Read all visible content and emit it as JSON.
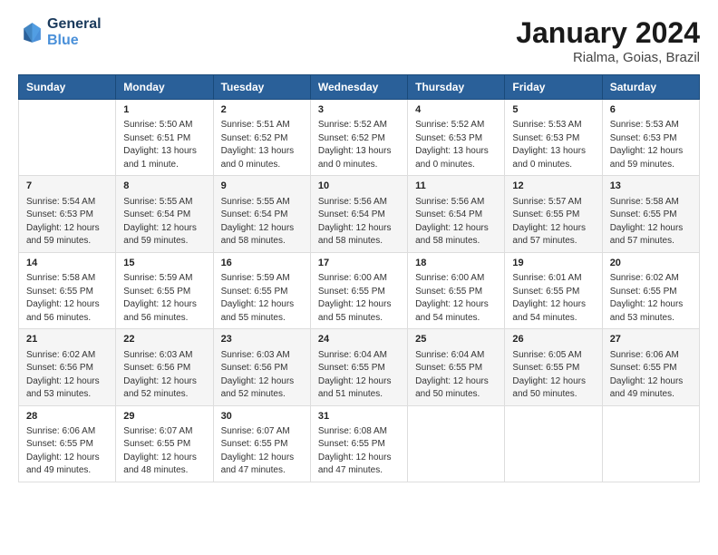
{
  "logo": {
    "line1": "General",
    "line2": "Blue"
  },
  "title": "January 2024",
  "subtitle": "Rialma, Goias, Brazil",
  "days_header": [
    "Sunday",
    "Monday",
    "Tuesday",
    "Wednesday",
    "Thursday",
    "Friday",
    "Saturday"
  ],
  "weeks": [
    [
      {
        "day": "",
        "content": ""
      },
      {
        "day": "1",
        "content": "Sunrise: 5:50 AM\nSunset: 6:51 PM\nDaylight: 13 hours\nand 1 minute."
      },
      {
        "day": "2",
        "content": "Sunrise: 5:51 AM\nSunset: 6:52 PM\nDaylight: 13 hours\nand 0 minutes."
      },
      {
        "day": "3",
        "content": "Sunrise: 5:52 AM\nSunset: 6:52 PM\nDaylight: 13 hours\nand 0 minutes."
      },
      {
        "day": "4",
        "content": "Sunrise: 5:52 AM\nSunset: 6:53 PM\nDaylight: 13 hours\nand 0 minutes."
      },
      {
        "day": "5",
        "content": "Sunrise: 5:53 AM\nSunset: 6:53 PM\nDaylight: 13 hours\nand 0 minutes."
      },
      {
        "day": "6",
        "content": "Sunrise: 5:53 AM\nSunset: 6:53 PM\nDaylight: 12 hours\nand 59 minutes."
      }
    ],
    [
      {
        "day": "7",
        "content": "Sunrise: 5:54 AM\nSunset: 6:53 PM\nDaylight: 12 hours\nand 59 minutes."
      },
      {
        "day": "8",
        "content": "Sunrise: 5:55 AM\nSunset: 6:54 PM\nDaylight: 12 hours\nand 59 minutes."
      },
      {
        "day": "9",
        "content": "Sunrise: 5:55 AM\nSunset: 6:54 PM\nDaylight: 12 hours\nand 58 minutes."
      },
      {
        "day": "10",
        "content": "Sunrise: 5:56 AM\nSunset: 6:54 PM\nDaylight: 12 hours\nand 58 minutes."
      },
      {
        "day": "11",
        "content": "Sunrise: 5:56 AM\nSunset: 6:54 PM\nDaylight: 12 hours\nand 58 minutes."
      },
      {
        "day": "12",
        "content": "Sunrise: 5:57 AM\nSunset: 6:55 PM\nDaylight: 12 hours\nand 57 minutes."
      },
      {
        "day": "13",
        "content": "Sunrise: 5:58 AM\nSunset: 6:55 PM\nDaylight: 12 hours\nand 57 minutes."
      }
    ],
    [
      {
        "day": "14",
        "content": "Sunrise: 5:58 AM\nSunset: 6:55 PM\nDaylight: 12 hours\nand 56 minutes."
      },
      {
        "day": "15",
        "content": "Sunrise: 5:59 AM\nSunset: 6:55 PM\nDaylight: 12 hours\nand 56 minutes."
      },
      {
        "day": "16",
        "content": "Sunrise: 5:59 AM\nSunset: 6:55 PM\nDaylight: 12 hours\nand 55 minutes."
      },
      {
        "day": "17",
        "content": "Sunrise: 6:00 AM\nSunset: 6:55 PM\nDaylight: 12 hours\nand 55 minutes."
      },
      {
        "day": "18",
        "content": "Sunrise: 6:00 AM\nSunset: 6:55 PM\nDaylight: 12 hours\nand 54 minutes."
      },
      {
        "day": "19",
        "content": "Sunrise: 6:01 AM\nSunset: 6:55 PM\nDaylight: 12 hours\nand 54 minutes."
      },
      {
        "day": "20",
        "content": "Sunrise: 6:02 AM\nSunset: 6:55 PM\nDaylight: 12 hours\nand 53 minutes."
      }
    ],
    [
      {
        "day": "21",
        "content": "Sunrise: 6:02 AM\nSunset: 6:56 PM\nDaylight: 12 hours\nand 53 minutes."
      },
      {
        "day": "22",
        "content": "Sunrise: 6:03 AM\nSunset: 6:56 PM\nDaylight: 12 hours\nand 52 minutes."
      },
      {
        "day": "23",
        "content": "Sunrise: 6:03 AM\nSunset: 6:56 PM\nDaylight: 12 hours\nand 52 minutes."
      },
      {
        "day": "24",
        "content": "Sunrise: 6:04 AM\nSunset: 6:55 PM\nDaylight: 12 hours\nand 51 minutes."
      },
      {
        "day": "25",
        "content": "Sunrise: 6:04 AM\nSunset: 6:55 PM\nDaylight: 12 hours\nand 50 minutes."
      },
      {
        "day": "26",
        "content": "Sunrise: 6:05 AM\nSunset: 6:55 PM\nDaylight: 12 hours\nand 50 minutes."
      },
      {
        "day": "27",
        "content": "Sunrise: 6:06 AM\nSunset: 6:55 PM\nDaylight: 12 hours\nand 49 minutes."
      }
    ],
    [
      {
        "day": "28",
        "content": "Sunrise: 6:06 AM\nSunset: 6:55 PM\nDaylight: 12 hours\nand 49 minutes."
      },
      {
        "day": "29",
        "content": "Sunrise: 6:07 AM\nSunset: 6:55 PM\nDaylight: 12 hours\nand 48 minutes."
      },
      {
        "day": "30",
        "content": "Sunrise: 6:07 AM\nSunset: 6:55 PM\nDaylight: 12 hours\nand 47 minutes."
      },
      {
        "day": "31",
        "content": "Sunrise: 6:08 AM\nSunset: 6:55 PM\nDaylight: 12 hours\nand 47 minutes."
      },
      {
        "day": "",
        "content": ""
      },
      {
        "day": "",
        "content": ""
      },
      {
        "day": "",
        "content": ""
      }
    ]
  ]
}
